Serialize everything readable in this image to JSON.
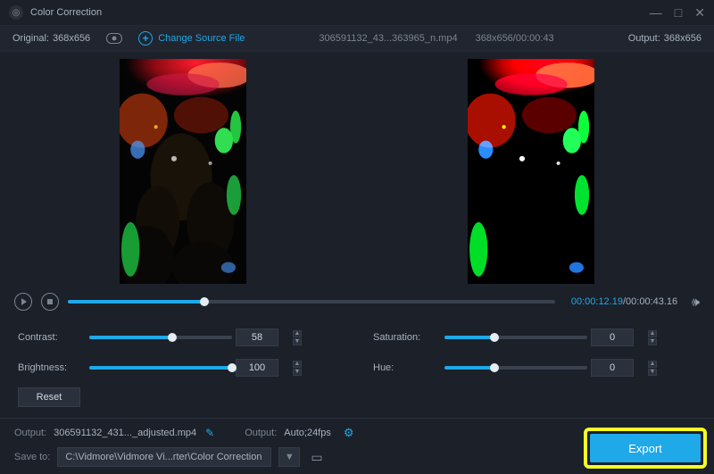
{
  "window": {
    "title": "Color Correction"
  },
  "topbar": {
    "original_label": "Original:",
    "original_dims": "368x656",
    "change_source": "Change Source File",
    "filename": "306591132_43...363965_n.mp4",
    "dims_time": "368x656/00:00:43",
    "output_label": "Output:",
    "output_dims": "368x656"
  },
  "playback": {
    "current": "00:00:12.19",
    "total": "00:00:43.16",
    "progress_pct": 28
  },
  "controls": {
    "contrast": {
      "label": "Contrast:",
      "value": 58,
      "pct": 58
    },
    "brightness": {
      "label": "Brightness:",
      "value": 100,
      "pct": 100
    },
    "saturation": {
      "label": "Saturation:",
      "value": 0,
      "pct": 35
    },
    "hue": {
      "label": "Hue:",
      "value": 0,
      "pct": 35
    },
    "reset": "Reset"
  },
  "footer": {
    "output_file_label": "Output:",
    "output_file": "306591132_431..._adjusted.mp4",
    "output_settings_label": "Output:",
    "output_settings": "Auto;24fps",
    "save_label": "Save to:",
    "save_path": "C:\\Vidmore\\Vidmore Vi...rter\\Color Correction",
    "export": "Export"
  }
}
